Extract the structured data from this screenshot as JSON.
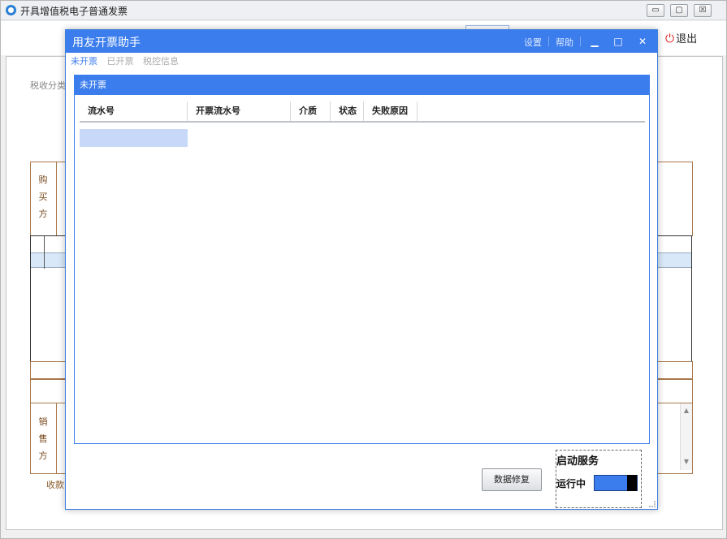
{
  "bg_window": {
    "title": "开具增值税电子普通发票",
    "controls": {
      "minimize": "▭",
      "restore": "▢",
      "close": "☒"
    },
    "exit_label": "退出",
    "tax_category_label": "税收分类",
    "buyer_label": [
      "购",
      "买",
      "方"
    ],
    "seller_label": [
      "销",
      "售",
      "方"
    ],
    "collect_label": "收款"
  },
  "dialog": {
    "title": "用友开票助手",
    "links": {
      "settings": "设置",
      "help": "帮助"
    },
    "controls": {
      "minimize": "▁",
      "maximize": "□",
      "close": "✕"
    },
    "tabs": [
      {
        "label": "未开票",
        "active": true
      },
      {
        "label": "已开票",
        "active": false
      },
      {
        "label": "税控信息",
        "active": false
      }
    ],
    "panel_title": "未开票",
    "columns": [
      "流水号",
      "开票流水号",
      "介质",
      "状态",
      "失败原因"
    ],
    "repair_button": "数据修复"
  },
  "service": {
    "title": "启动服务",
    "status": "运行中",
    "toggle_on": true
  },
  "colors": {
    "accent": "#3c7ded",
    "selection": "#c7d8f8",
    "exit_icon": "#e02020"
  }
}
